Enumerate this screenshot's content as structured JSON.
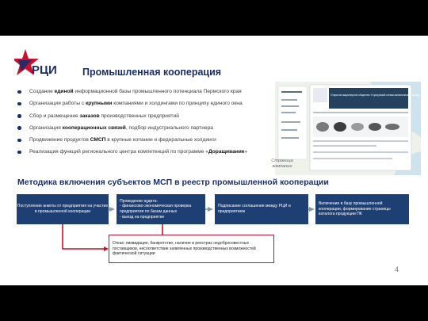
{
  "header": {
    "logo_text": "РЦИ",
    "title": "Промышленная кооперация"
  },
  "bullets": [
    {
      "pre": "Создание ",
      "bold": "единой",
      "post": " информационной базы промышленного потенциала Пермского края"
    },
    {
      "pre": "Организация работы с ",
      "bold": "крупными",
      "post": " компаниями и холдингами по принципу единого окна"
    },
    {
      "pre": "Сбор и размещение ",
      "bold": "заказов",
      "post": " производственных предприятий"
    },
    {
      "pre": "Организация ",
      "bold": "кооперационных связей",
      "post": ", подбор индустриального партнера"
    },
    {
      "pre": "Продвижение продуктов ",
      "bold": "СМСП",
      "post": " в крупные копании и федеральные холдинги"
    },
    {
      "pre": "Реализация функций регионального центра компетенций по программе «",
      "bold": "Доращивание",
      "post": "»"
    }
  ],
  "screenshot": {
    "company_title": "Открытое акционерное общество «Суксунский оптико-механический завод»",
    "caption": "Страница компании"
  },
  "methodology": {
    "title": "Методика включения субъектов МСП в реестр промышленной кооперации",
    "steps": [
      "Поступление анкеты от предприятия на участие в промышленной кооперации",
      "Проведение аудита:\n- финансово-экономическая проверка предприятия по базам данных\n- выезд на предприятие",
      "Подписание соглашения между РЦИ и предприятием",
      "Включение в базу промышленной кооперации, формирование страницы каталога продукции ПК"
    ],
    "rejection": "Отказ: ликвидация, банкротство, наличие в реестрах недобросовестных поставщиков, несоответствие заявленных производственных возможностей фактической ситуации"
  },
  "page_number": "4",
  "colors": {
    "brand_navy": "#1b2d6b",
    "box_blue": "#1e3f73",
    "accent_red": "#c8102e",
    "arrow_grey": "#8a95a8"
  }
}
